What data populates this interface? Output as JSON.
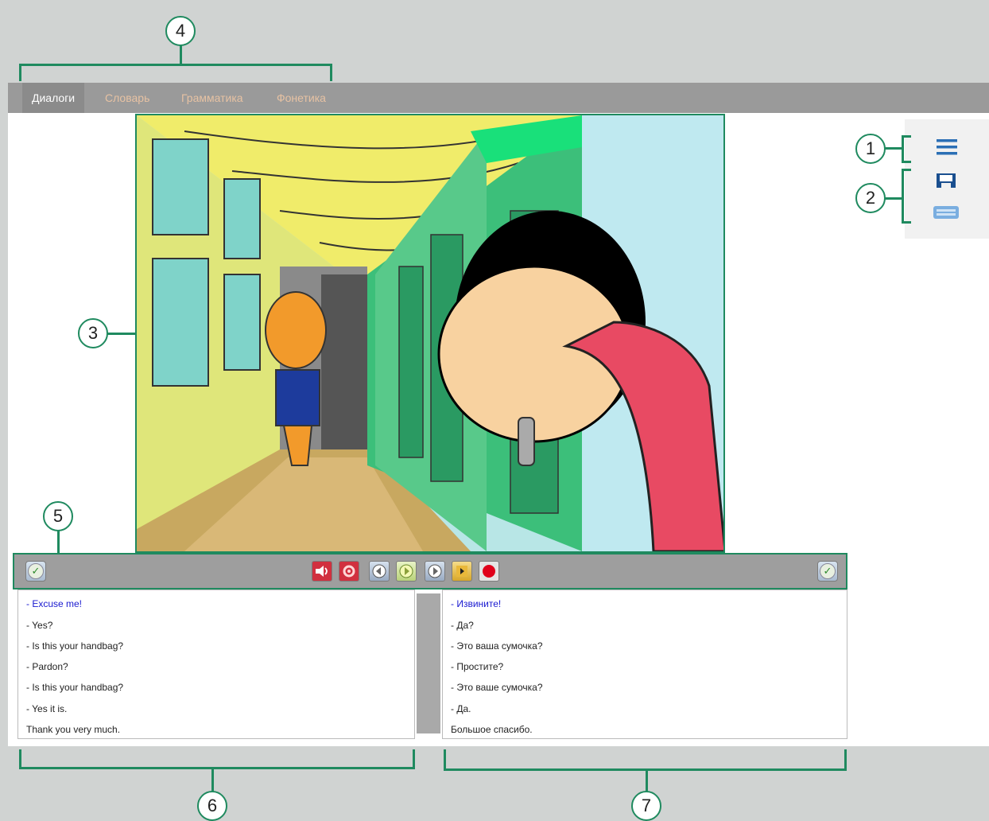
{
  "menu": {
    "tabs": [
      {
        "label": "Диалоги",
        "active": true
      },
      {
        "label": "Словарь",
        "active": false
      },
      {
        "label": "Грамматика",
        "active": false
      },
      {
        "label": "Фонетика",
        "active": false
      }
    ]
  },
  "callouts": {
    "c1": "1",
    "c2": "2",
    "c3": "3",
    "c4": "4",
    "c5": "5",
    "c6": "6",
    "c7": "7"
  },
  "side_icons": [
    "menu-icon",
    "save-icon",
    "keyboard-icon"
  ],
  "controls": {
    "left_check": "check-icon",
    "buttons": [
      "sound-icon",
      "settings-icon",
      "rewind-icon",
      "play-icon",
      "forward-icon",
      "step-icon",
      "record-icon"
    ],
    "right_check": "check-icon"
  },
  "dialog": {
    "english": [
      "- Excuse me!",
      "- Yes?",
      "- Is this your handbag?",
      "- Pardon?",
      "- Is this your handbag?",
      "- Yes it is.",
      "Thank you very much."
    ],
    "russian": [
      "- Извините!",
      "- Да?",
      "- Это ваша сумочка?",
      "- Простите?",
      "- Это ваше сумочка?",
      "- Да.",
      "Большое спасибо."
    ]
  },
  "colors": {
    "accent": "#1f8a5f",
    "menubar": "#9a9a9a",
    "highlight_text": "#1a1ad0",
    "record": "#e0001a"
  }
}
